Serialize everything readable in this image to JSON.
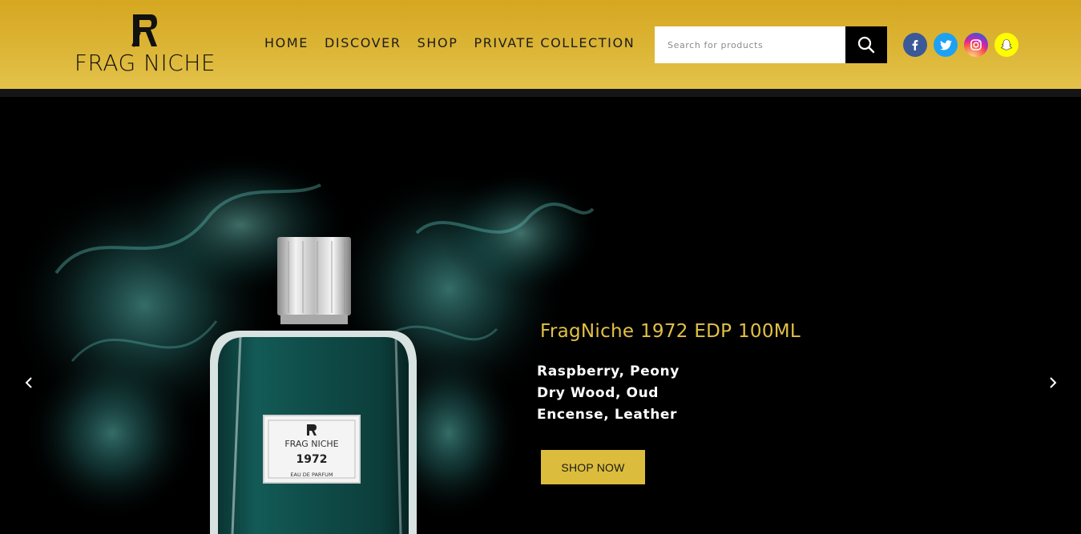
{
  "brand": {
    "name": "FRAG NICHE"
  },
  "nav": {
    "items": [
      "HOME",
      "DISCOVER",
      "SHOP",
      "PRIVATE COLLECTION"
    ]
  },
  "search": {
    "placeholder": "Search for products",
    "value": ""
  },
  "social": [
    "facebook-icon",
    "twitter-icon",
    "instagram-icon",
    "snapchat-icon"
  ],
  "slide": {
    "title": "FragNiche 1972 EDP 100ML",
    "notes": [
      "Raspberry, Peony",
      "Dry Wood, Oud",
      "Encense, Leather"
    ],
    "cta": "SHOP NOW",
    "bottle_label": {
      "brand": "FRAG NICHE",
      "name": "1972",
      "type": "EAU DE PARFUM"
    }
  },
  "colors": {
    "header": "#dcb536",
    "accent": "#e2c145",
    "button": "#dcbc3c",
    "bottle": "#0e4a47"
  }
}
